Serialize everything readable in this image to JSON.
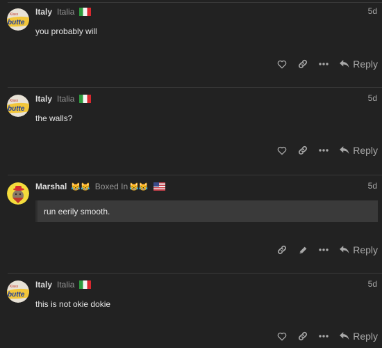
{
  "posts": [
    {
      "username": "Italy",
      "full_name": "Italia",
      "flag": "italy-flag",
      "date": "5d",
      "body": "you probably will",
      "actions": [
        "like",
        "copy-link",
        "more"
      ],
      "reply_label": "Reply"
    },
    {
      "username": "Italy",
      "full_name": "Italia",
      "flag": "italy-flag",
      "date": "5d",
      "body": "the walls?",
      "actions": [
        "like",
        "copy-link",
        "more"
      ],
      "reply_label": "Reply"
    },
    {
      "username": "Marshal",
      "name_emojis": "😹😹",
      "full_name": "Boxed In",
      "full_name_emojis": "😹😹",
      "flag": "us-flag",
      "date": "5d",
      "quote": "run eerily smooth.",
      "actions": [
        "copy-link",
        "edit",
        "more"
      ],
      "reply_label": "Reply"
    },
    {
      "username": "Italy",
      "full_name": "Italia",
      "flag": "italy-flag",
      "date": "5d",
      "body": "this is not okie dokie",
      "actions": [
        "like",
        "copy-link",
        "more"
      ],
      "reply_label": "Reply"
    }
  ],
  "colors": {
    "background": "#222222",
    "divider": "#3a3a3a",
    "quote_background": "#3a3a3a",
    "muted_text": "#969696",
    "icon": "#a8a8a8"
  }
}
